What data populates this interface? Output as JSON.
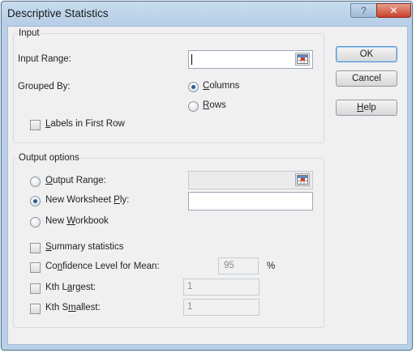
{
  "window": {
    "title": "Descriptive Statistics",
    "help_glyph": "?",
    "close_glyph": "✕"
  },
  "input": {
    "group_title": "Input",
    "input_range_label": "Input Range:",
    "input_range_value": "",
    "grouped_by_label": "Grouped By:",
    "grouped_by_options": [
      {
        "pre": "",
        "key": "C",
        "post": "olumns",
        "selected": true
      },
      {
        "pre": "",
        "key": "R",
        "post": "ows",
        "selected": false
      }
    ],
    "labels_first_row": {
      "pre": "",
      "key": "L",
      "post": "abels in First Row",
      "checked": false
    }
  },
  "output": {
    "group_title": "Output options",
    "destinations": [
      {
        "pre": "",
        "key": "O",
        "post": "utput Range:",
        "selected": false
      },
      {
        "pre": "New Worksheet ",
        "key": "P",
        "post": "ly:",
        "selected": true
      },
      {
        "pre": "New ",
        "key": "W",
        "post": "orkbook",
        "selected": false
      }
    ],
    "output_range_value": "",
    "worksheet_ply_value": "",
    "summary_statistics": {
      "pre": "",
      "key": "S",
      "post": "ummary statistics",
      "checked": false
    },
    "confidence_level": {
      "pre": "Co",
      "key": "n",
      "post": "fidence Level for Mean:",
      "checked": false,
      "value": "95",
      "unit": "%"
    },
    "kth_largest": {
      "pre": "Kth L",
      "key": "a",
      "post": "rgest:",
      "checked": false,
      "value": "1"
    },
    "kth_smallest": {
      "pre": "Kth S",
      "key": "m",
      "post": "allest:",
      "checked": false,
      "value": "1"
    }
  },
  "buttons": {
    "ok": "OK",
    "cancel": "Cancel",
    "help_pre": "",
    "help_key": "H",
    "help_post": "elp"
  },
  "colors": {
    "frame": "#b8d0e8",
    "client": "#f0f0f0",
    "close": "#c9412b",
    "radio_dot": "#2a5a91"
  },
  "icons": {
    "range_selector": "range-select-icon"
  }
}
